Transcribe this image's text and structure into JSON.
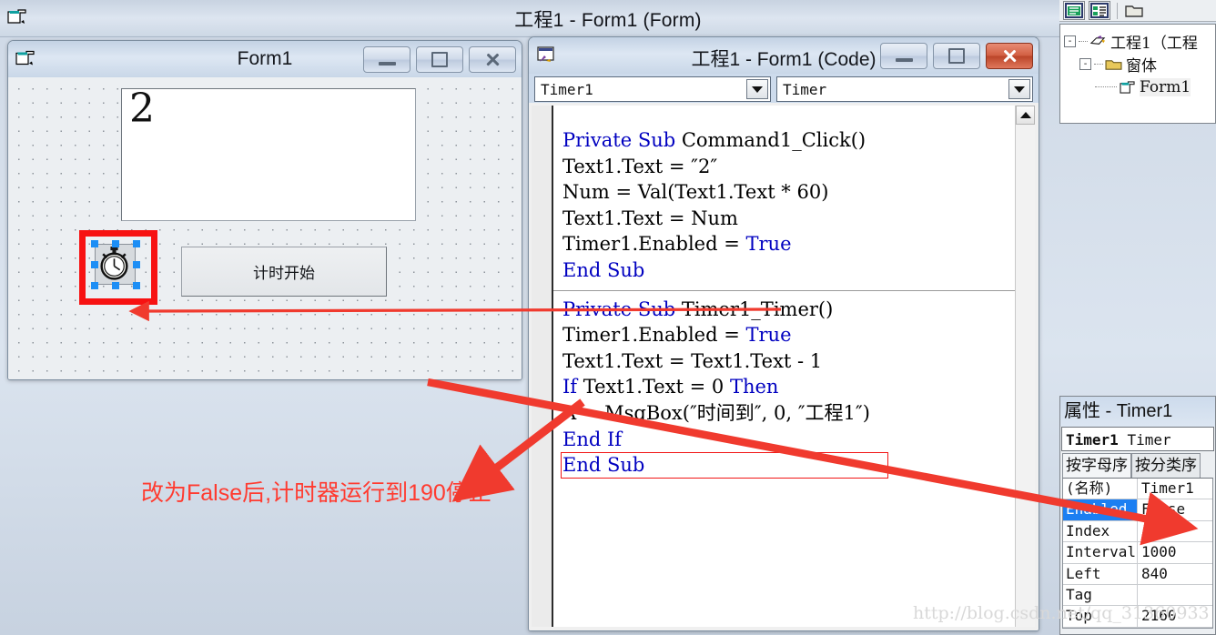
{
  "outer_window": {
    "title": "工程1 - Form1 (Form)",
    "icon": "form-window-icon"
  },
  "form_designer": {
    "title": "Form1",
    "icon": "form-window-icon",
    "buttons": {
      "minimize": "minimize-icon",
      "maximize": "maximize-icon",
      "close": "close-icon"
    },
    "textbox": {
      "name": "Text1",
      "value": "2"
    },
    "command_button": {
      "name": "Command1",
      "caption": "计时开始"
    },
    "timer_control": {
      "name": "Timer1",
      "icon": "stopwatch-icon",
      "selected": true
    }
  },
  "code_window": {
    "title": "工程1 - Form1 (Code)",
    "icon": "code-window-icon",
    "object_combo": {
      "value": "Timer1",
      "arrow": "chevron-down-icon"
    },
    "proc_combo": {
      "value": "Timer",
      "arrow": "chevron-down-icon"
    },
    "scroll_up": "caret-up-icon",
    "procedures": [
      {
        "name": "Command1_Click",
        "lines": [
          [
            {
              "t": "Private ",
              "k": true
            },
            {
              "t": "Sub ",
              "k": true
            },
            {
              "t": "Command1_Click()",
              "k": false
            }
          ],
          [
            {
              "t": "Text1.Text = ″2″",
              "k": false
            }
          ],
          [
            {
              "t": "Num = Val(Text1.Text * 60)",
              "k": false
            }
          ],
          [
            {
              "t": "Text1.Text = Num",
              "k": false
            }
          ],
          [
            {
              "t": "Timer1.Enabled = ",
              "k": false
            },
            {
              "t": "True",
              "k": true
            }
          ],
          [
            {
              "t": "End Sub",
              "k": true
            }
          ]
        ]
      },
      {
        "name": "Timer1_Timer",
        "lines": [
          [
            {
              "t": "Private ",
              "k": true
            },
            {
              "t": "Sub ",
              "k": true
            },
            {
              "t": "Timer1_Timer()",
              "k": false
            }
          ],
          [
            {
              "t": "Timer1.Enabled = ",
              "k": false
            },
            {
              "t": "True",
              "k": true
            }
          ],
          [
            {
              "t": "Text1.Text = Text1.Text - 1",
              "k": false
            }
          ],
          [
            {
              "t": "If ",
              "k": true
            },
            {
              "t": "Text1.Text = 0 ",
              "k": false
            },
            {
              "t": "Then",
              "k": true
            }
          ],
          [
            {
              "t": "A = MsgBox(″时间到″, 0, ″工程1″)",
              "k": false
            }
          ],
          [
            {
              "t": "End If",
              "k": true
            }
          ],
          [
            {
              "t": "End Sub",
              "k": true
            }
          ]
        ]
      }
    ],
    "highlighted_line": "Timer1.Enabled = True"
  },
  "project_explorer": {
    "toolbar": [
      "view-code-icon",
      "view-object-icon",
      "toggle-folders-icon"
    ],
    "nodes": [
      {
        "label": "工程1（工程",
        "icon": "project-icon",
        "expander": "-",
        "depth": 0
      },
      {
        "label": "窗体",
        "icon": "folder-icon",
        "expander": "-",
        "depth": 1
      },
      {
        "label": "Form1",
        "icon": "form-icon",
        "expander": "",
        "depth": 2,
        "selected": true
      }
    ]
  },
  "properties_window": {
    "title": "属性 - Timer1",
    "object_name": "Timer1",
    "object_type": "Timer",
    "tabs": [
      {
        "label": "按字母序",
        "active": true
      },
      {
        "label": "按分类序",
        "active": false
      }
    ],
    "rows": [
      {
        "name": "(名称)",
        "value": "Timer1",
        "selected": false
      },
      {
        "name": "Enabled",
        "value": "False",
        "selected": true
      },
      {
        "name": "Index",
        "value": "",
        "selected": false
      },
      {
        "name": "Interval",
        "value": "1000",
        "selected": false
      },
      {
        "name": "Left",
        "value": "840",
        "selected": false
      },
      {
        "name": "Tag",
        "value": "",
        "selected": false
      },
      {
        "name": "Top",
        "value": "2160",
        "selected": false
      }
    ]
  },
  "annotations": {
    "note_text": "改为False后,计时器运行到190停止",
    "note_color": "#ff3b30",
    "arrow_color": "#f03a2e",
    "highlight_box_color": "#f21616",
    "selection_box_color": "#f71212"
  },
  "watermark": "http://blog.csdn.net/qq_31360933"
}
